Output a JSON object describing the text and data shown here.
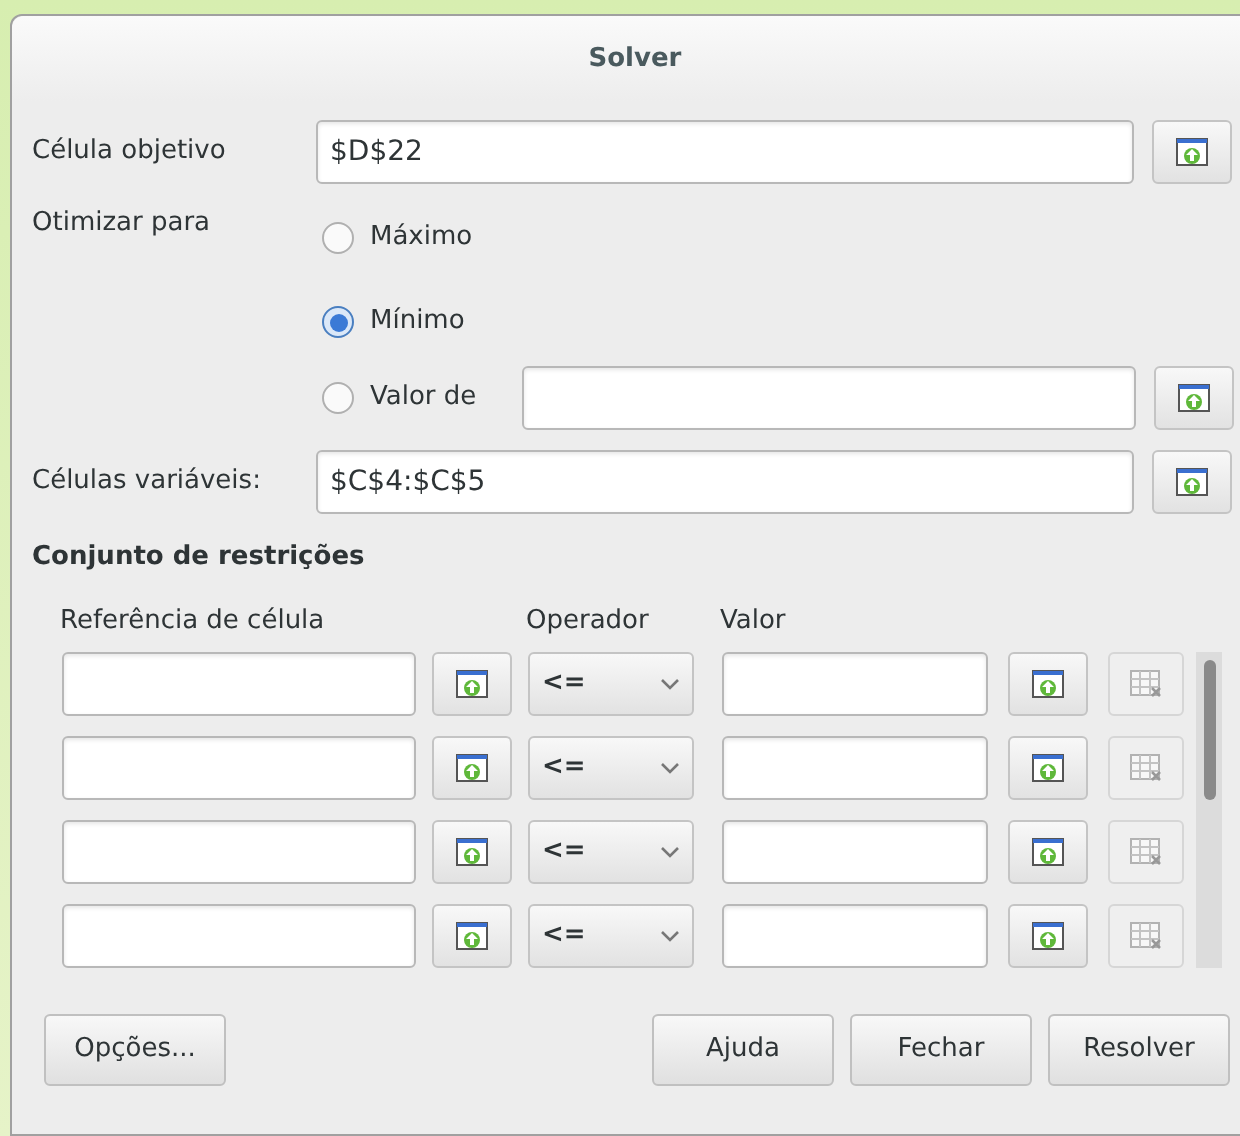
{
  "window": {
    "title": "Solver"
  },
  "target_cell": {
    "label": "Célula objetivo",
    "value": "$D$22"
  },
  "optimize": {
    "label": "Otimizar para",
    "options": [
      {
        "label": "Máximo",
        "selected": false,
        "kind": "plain"
      },
      {
        "label": "Mínimo",
        "selected": true,
        "kind": "plain"
      },
      {
        "label": "Valor de",
        "selected": false,
        "kind": "value"
      }
    ]
  },
  "variable_cells": {
    "label": "Células variáveis:",
    "value": "$C$4:$C$5"
  },
  "constraints": {
    "title": "Conjunto de restrições",
    "columns": [
      "Referência de célula",
      "Operador",
      "Valor"
    ],
    "rows": [
      {
        "operator": "<="
      },
      {
        "operator": "<="
      },
      {
        "operator": "<="
      },
      {
        "operator": "<="
      }
    ]
  },
  "buttons": {
    "left": [
      "Opções..."
    ],
    "right": [
      "Ajuda",
      "Fechar",
      "Resolver"
    ]
  }
}
